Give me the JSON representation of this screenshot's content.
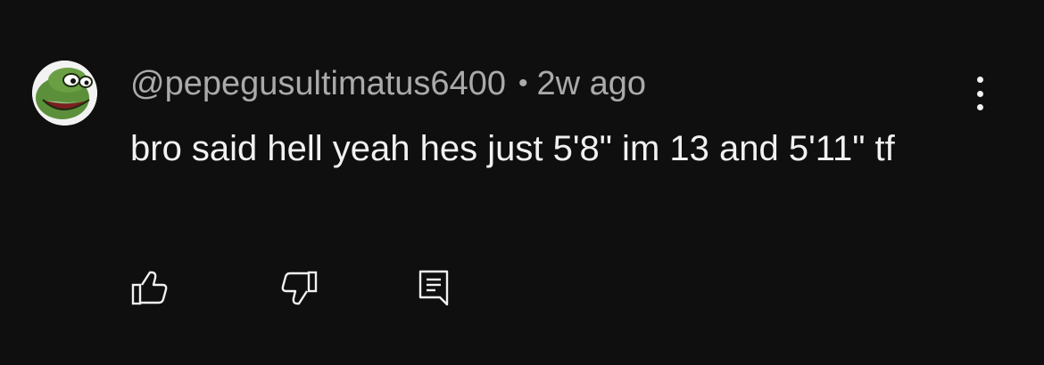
{
  "comment": {
    "author": "@pepegusultimatus6400",
    "separator": "•",
    "time_ago": "2w ago",
    "text": "bro said hell yeah hes just 5'8\" im 13 and 5'11\" tf",
    "avatar_icon": "pepe-frog-avatar",
    "menu_icon": "more-vertical-icon"
  },
  "actions": {
    "like_icon": "thumbs-up-icon",
    "dislike_icon": "thumbs-down-icon",
    "reply_icon": "reply-comment-icon"
  },
  "colors": {
    "background": "#0f0f0f",
    "primary_text": "#f1f1f1",
    "secondary_text": "#aaaaaa"
  }
}
